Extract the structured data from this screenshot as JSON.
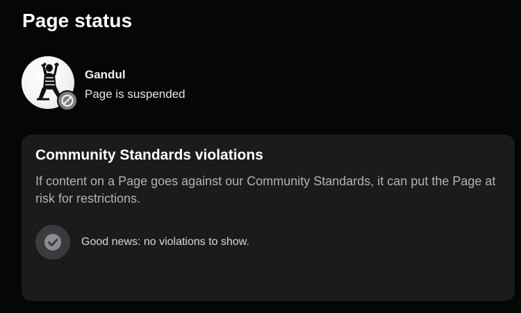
{
  "page": {
    "title": "Page status"
  },
  "profile": {
    "name": "Gandul",
    "status": "Page is suspended",
    "avatar_icon": "sitting-figure-logo",
    "badge_icon": "prohibited-icon"
  },
  "violations_card": {
    "title": "Community Standards violations",
    "description": "If content on a Page goes against our Community Standards, it can put the Page at risk for restrictions.",
    "empty_state": {
      "icon": "checkmark-icon",
      "text": "Good news: no violations to show."
    }
  },
  "colors": {
    "background": "#060606",
    "card_background": "#1b1b1b",
    "secondary_text": "#b0b3b8",
    "badge_gray": "#7b7e83"
  }
}
